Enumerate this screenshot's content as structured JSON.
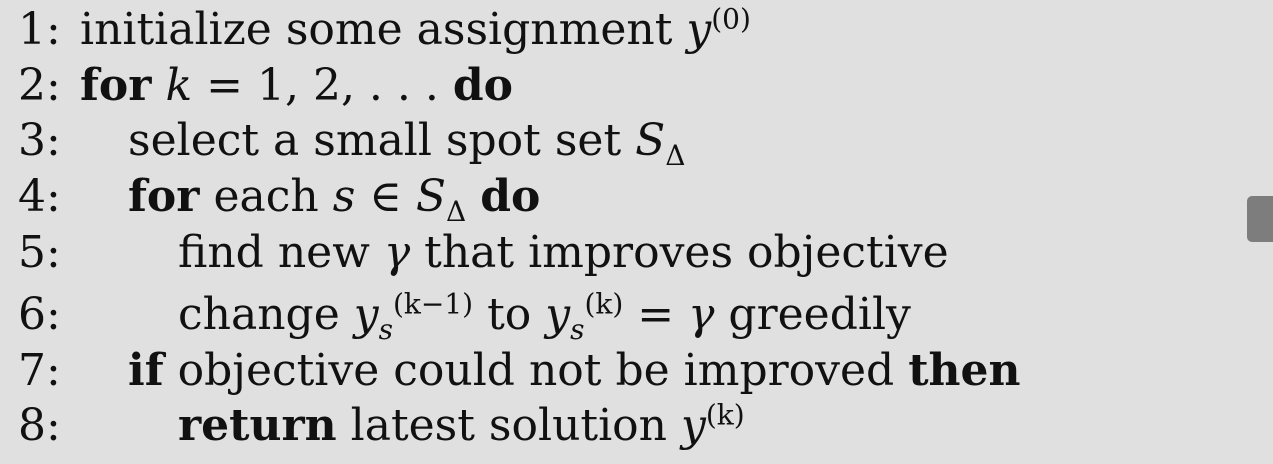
{
  "lines": [
    {
      "num": "1:",
      "parts": [
        {
          "text": "initialize some assignment "
        },
        {
          "text": "y",
          "italic": true
        },
        {
          "text": "(0)",
          "sup": true
        }
      ]
    },
    {
      "num": "2:",
      "parts": [
        {
          "text": "for",
          "bold": true
        },
        {
          "text": " "
        },
        {
          "text": "k",
          "italic": true
        },
        {
          "text": " = 1, 2, . . . "
        },
        {
          "text": "do",
          "bold": true
        }
      ]
    },
    {
      "num": "3:",
      "indent": 1,
      "parts": [
        {
          "text": "select a small spot set "
        },
        {
          "text": "S",
          "italic": true
        },
        {
          "text": "Δ",
          "sub": true
        }
      ]
    },
    {
      "num": "4:",
      "indent": 1,
      "parts": [
        {
          "text": "for",
          "bold": true
        },
        {
          "text": " each "
        },
        {
          "text": "s",
          "italic": true
        },
        {
          "text": " ∈ "
        },
        {
          "text": "S",
          "italic": true
        },
        {
          "text": "Δ",
          "sub": true
        },
        {
          "text": " "
        },
        {
          "text": "do",
          "bold": true
        }
      ]
    },
    {
      "num": "5:",
      "indent": 2,
      "parts": [
        {
          "text": "find new "
        },
        {
          "text": "γ",
          "italic": true
        },
        {
          "text": " that improves objective"
        }
      ]
    },
    {
      "num": "6:",
      "indent": 2,
      "parts": [
        {
          "text": "change "
        },
        {
          "text": "y",
          "italic": true
        },
        {
          "text": "s",
          "sub": true,
          "italic": true
        },
        {
          "text": "(k−1)",
          "sup": true
        },
        {
          "text": " to "
        },
        {
          "text": "y",
          "italic": true
        },
        {
          "text": "s",
          "sub": true,
          "italic": true
        },
        {
          "text": "(k)",
          "sup": true
        },
        {
          "text": " = "
        },
        {
          "text": "γ",
          "italic": true
        },
        {
          "text": " greedily"
        }
      ]
    },
    {
      "num": "7:",
      "indent": 1,
      "parts": [
        {
          "text": "if",
          "bold": true
        },
        {
          "text": " objective could not be improved "
        },
        {
          "text": "then",
          "bold": true
        }
      ]
    },
    {
      "num": "8:",
      "indent": 2,
      "parts": [
        {
          "text": "return",
          "bold": true
        },
        {
          "text": "  latest solution "
        },
        {
          "text": "y",
          "italic": true
        },
        {
          "text": "(k)",
          "sup": true
        }
      ]
    }
  ]
}
